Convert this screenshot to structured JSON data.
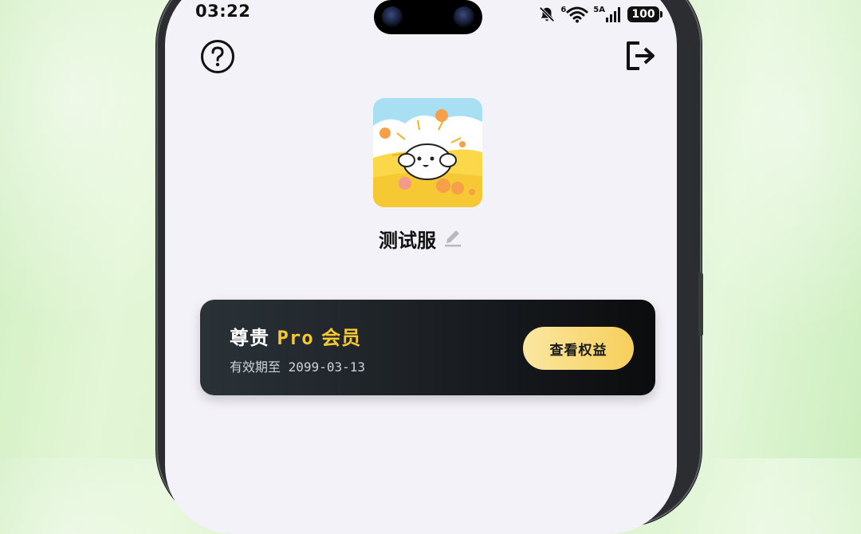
{
  "status_bar": {
    "time": "03:22",
    "wifi_label": "6",
    "network_label": "5A",
    "battery": "100"
  },
  "user": {
    "name": "测试服"
  },
  "membership": {
    "prefix": "尊贵",
    "plan": "Pro",
    "tier": "会员",
    "expiry_label": "有效期至",
    "expiry_date": "2099-03-13",
    "benefits_button": "查看权益"
  },
  "icons": {
    "help": "question-circle-icon",
    "logout": "logout-icon",
    "edit": "pencil-icon",
    "mute": "bell-off-icon",
    "wifi": "wifi-icon",
    "signal": "signal-icon"
  },
  "colors": {
    "accent_gold": "#f7c831",
    "card_dark": "#1a1e22",
    "screen_bg": "#f3f2f8"
  }
}
